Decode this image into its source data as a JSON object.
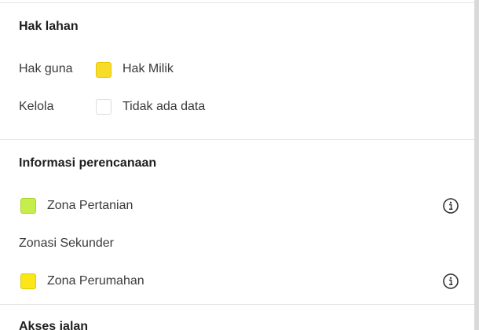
{
  "hak_lahan": {
    "title": "Hak lahan",
    "row1_label": "Hak guna",
    "row1_value": "Hak Milik",
    "row1_color": "#f7dd2a",
    "row2_label": "Kelola",
    "row2_value": "Tidak ada data",
    "row2_color": "#ffffff"
  },
  "perencanaan": {
    "title": "Informasi perencanaan",
    "zona_pertanian": {
      "label": "Zona Pertanian",
      "color": "#c5ee4a",
      "icon": "info-icon"
    },
    "subheading": "Zonasi Sekunder",
    "zona_perumahan": {
      "label": "Zona Perumahan",
      "color": "#fbe719",
      "icon": "info-icon"
    }
  },
  "akses_jalan": {
    "title": "Akses jalan"
  }
}
